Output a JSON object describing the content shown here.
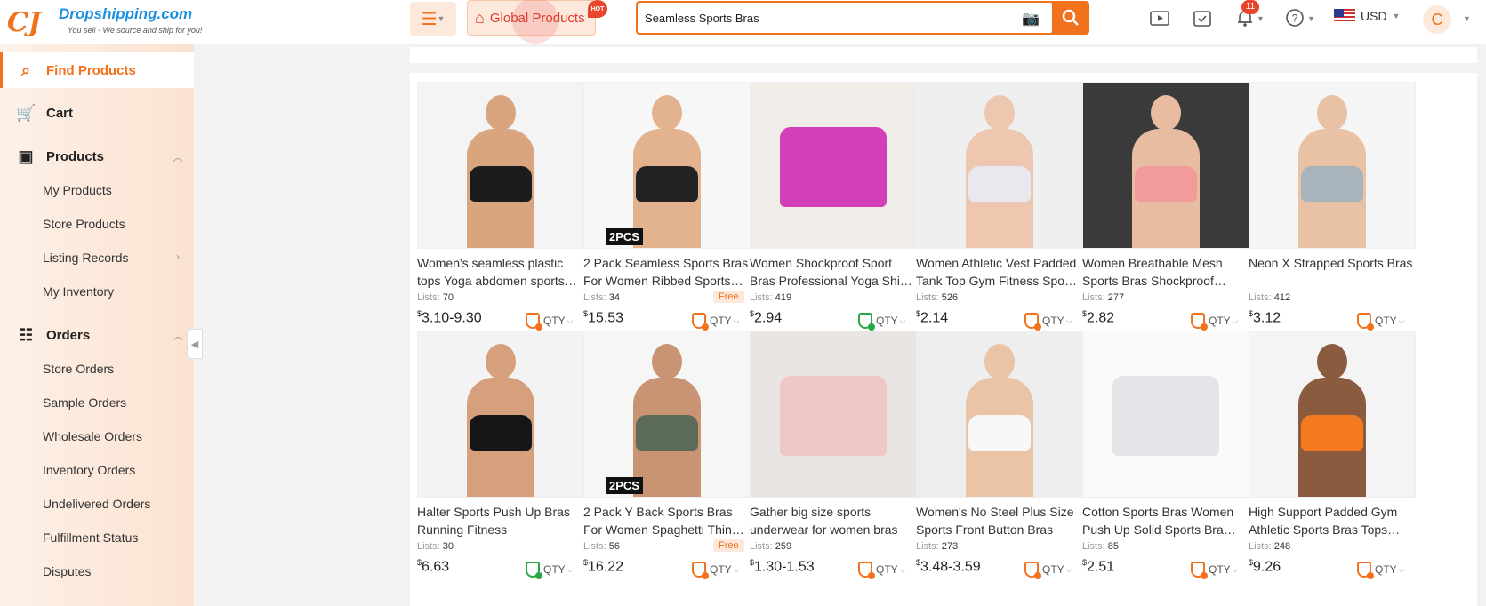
{
  "logo": {
    "name": "Dropshipping.com",
    "tagline": "You sell - We source and ship for you!"
  },
  "header": {
    "global_products_label": "Global Products",
    "hot_badge": "HOT",
    "search_value": "Seamless Sports Bras",
    "notification_count": "11",
    "currency": "USD",
    "avatar_initial": "C"
  },
  "sidebar": {
    "find_products": "Find Products",
    "cart": "Cart",
    "products": "Products",
    "products_sub": [
      "My Products",
      "Store Products",
      "Listing Records",
      "My Inventory"
    ],
    "orders": "Orders",
    "orders_sub": [
      "Store Orders",
      "Sample Orders",
      "Wholesale Orders",
      "Inventory Orders",
      "Undelivered Orders",
      "Fulfillment Status",
      "Disputes"
    ]
  },
  "products": [
    {
      "title": "Women's seamless plastic tops Yoga abdomen sports…",
      "lists_label": "Lists:",
      "lists": "70",
      "price": "3.10-9.30",
      "free": "",
      "shield": "orange",
      "qty": "QTY"
    },
    {
      "title": "2 Pack Seamless Sports Bras For Women Ribbed Sports…",
      "lists_label": "Lists:",
      "lists": "34",
      "price": "15.53",
      "free": "Free",
      "shield": "orange",
      "qty": "QTY",
      "badge": "2PCS"
    },
    {
      "title": "Women Shockproof Sport Bras Professional Yoga Shi…",
      "lists_label": "Lists:",
      "lists": "419",
      "price": "2.94",
      "free": "",
      "shield": "green",
      "qty": "QTY"
    },
    {
      "title": "Women Athletic Vest Padded Tank Top Gym Fitness Spo…",
      "lists_label": "Lists:",
      "lists": "526",
      "price": "2.14",
      "free": "",
      "shield": "orange",
      "qty": "QTY"
    },
    {
      "title": "Women Breathable Mesh Sports Bras Shockproof…",
      "lists_label": "Lists:",
      "lists": "277",
      "price": "2.82",
      "free": "",
      "shield": "orange",
      "qty": "QTY"
    },
    {
      "title": "Neon X Strapped Sports Bras",
      "lists_label": "Lists:",
      "lists": "412",
      "price": "3.12",
      "free": "",
      "shield": "orange",
      "qty": "QTY"
    },
    {
      "title": "Halter Sports Push Up Bras Running Fitness",
      "lists_label": "Lists:",
      "lists": "30",
      "price": "6.63",
      "free": "",
      "shield": "green",
      "qty": "QTY"
    },
    {
      "title": "2 Pack Y Back Sports Bras For Women Spaghetti Thin…",
      "lists_label": "Lists:",
      "lists": "56",
      "price": "16.22",
      "free": "Free",
      "shield": "orange",
      "qty": "QTY",
      "badge": "2PCS"
    },
    {
      "title": "Gather big size sports underwear for women bras",
      "lists_label": "Lists:",
      "lists": "259",
      "price": "1.30-1.53",
      "free": "",
      "shield": "orange",
      "qty": "QTY"
    },
    {
      "title": "Women's No Steel Plus Size Sports Front Button Bras",
      "lists_label": "Lists:",
      "lists": "273",
      "price": "3.48-3.59",
      "free": "",
      "shield": "orange",
      "qty": "QTY"
    },
    {
      "title": "Cotton Sports Bras Women Push Up Solid Sports Bra…",
      "lists_label": "Lists:",
      "lists": "85",
      "price": "2.51",
      "free": "",
      "shield": "orange",
      "qty": "QTY"
    },
    {
      "title": "High Support Padded Gym Athletic Sports Bras Tops…",
      "lists_label": "Lists:",
      "lists": "248",
      "price": "9.26",
      "free": "",
      "shield": "orange",
      "qty": "QTY"
    }
  ],
  "currency_symbol": "$",
  "colors": {
    "accent": "#f2711c",
    "link_blue": "#1d8fe1",
    "hot_red": "#e8452c",
    "verified_green": "#27a844"
  }
}
